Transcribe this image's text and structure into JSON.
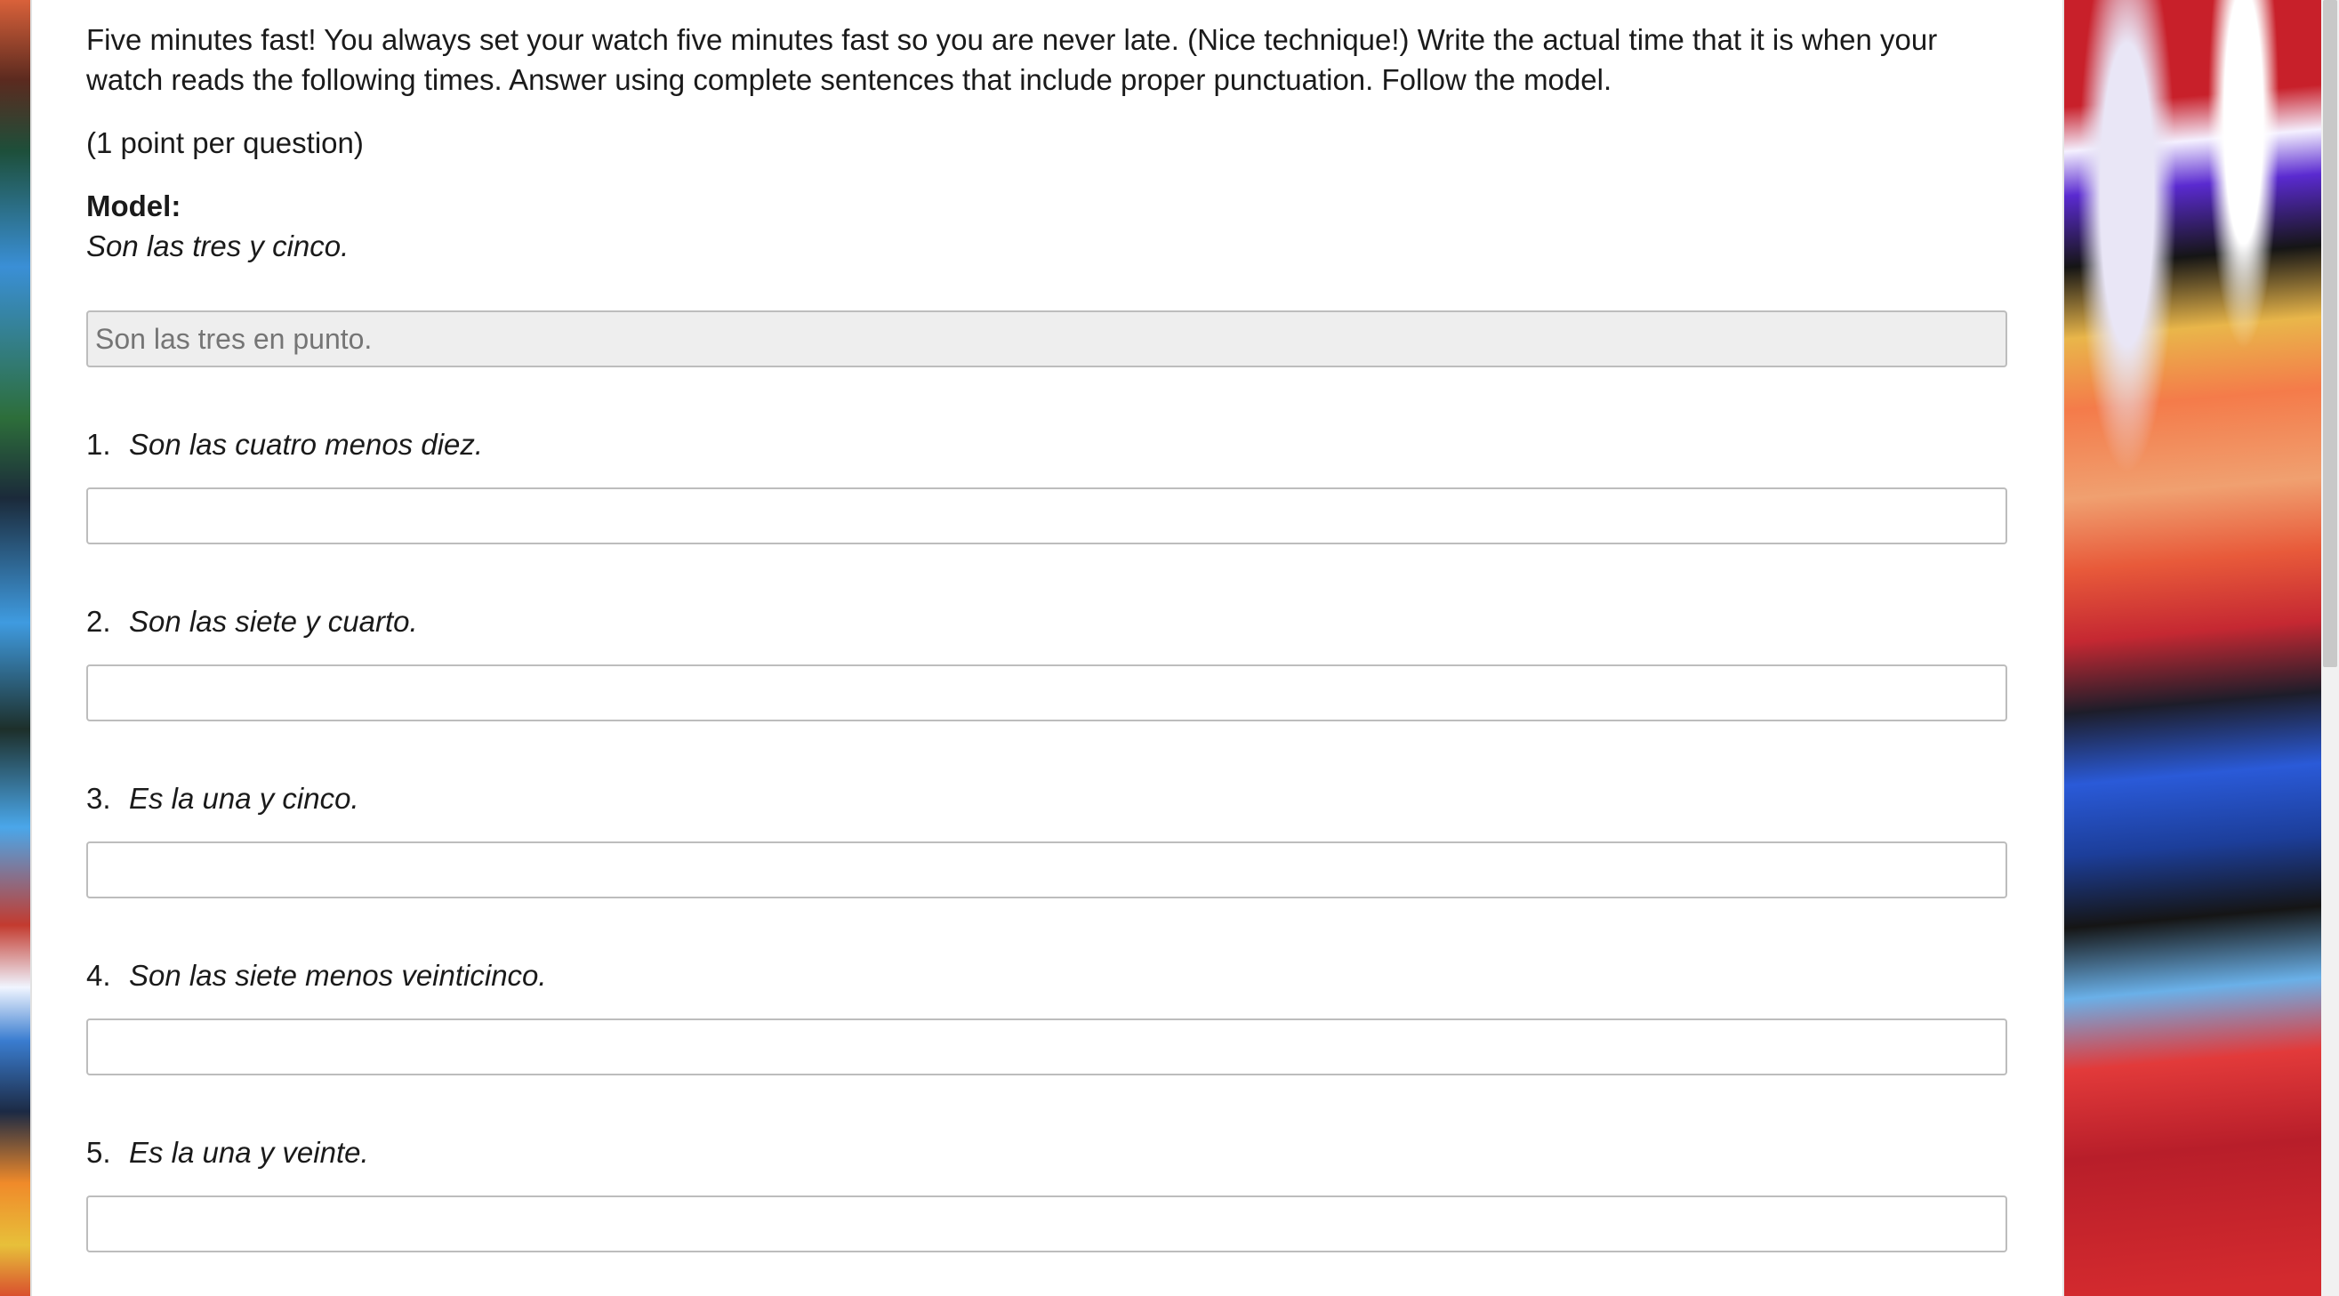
{
  "instructions": "Five minutes fast! You always set your watch five minutes fast so you are never late. (Nice technique!) Write the actual time that it is when your watch reads the following times. Answer using complete sentences that include proper punctuation. Follow the model.",
  "points_note": "(1 point per question)",
  "model": {
    "label": "Model:",
    "prompt": "Son las tres y cinco.",
    "answer_placeholder": "Son las tres en punto."
  },
  "questions": [
    {
      "number": "1.",
      "text": "Son las cuatro menos diez.",
      "answer": ""
    },
    {
      "number": "2.",
      "text": "Son las siete y cuarto.",
      "answer": ""
    },
    {
      "number": "3.",
      "text": "Es la una y cinco.",
      "answer": ""
    },
    {
      "number": "4.",
      "text": "Son las siete menos veinticinco.",
      "answer": ""
    },
    {
      "number": "5.",
      "text": "Es la una y veinte.",
      "answer": ""
    }
  ],
  "colors": {
    "input_border": "#bdbdbd",
    "readonly_bg": "#eeeeee",
    "placeholder_text": "#9a9a9a"
  }
}
